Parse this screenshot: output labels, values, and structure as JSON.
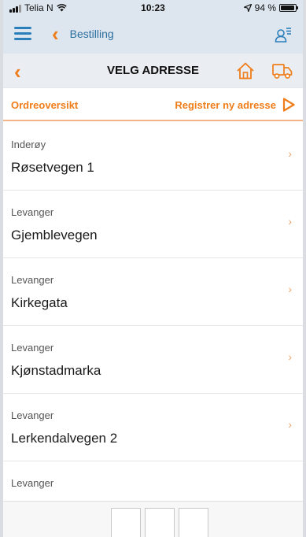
{
  "status_bar": {
    "carrier": "Telia N",
    "time": "10:23",
    "battery_percent": 94,
    "battery_label": "94 %"
  },
  "top_nav": {
    "title": "Bestilling"
  },
  "page_header": {
    "title": "VELG ADRESSE"
  },
  "actions": {
    "order_overview": "Ordreoversikt",
    "register_address": "Registrer ny adresse"
  },
  "addresses": [
    {
      "city": "Inderøy",
      "street": "Røsetvegen 1"
    },
    {
      "city": "Levanger",
      "street": "Gjemblevegen"
    },
    {
      "city": "Levanger",
      "street": "Kirkegata"
    },
    {
      "city": "Levanger",
      "street": "Kjønstadmarka"
    },
    {
      "city": "Levanger",
      "street": "Lerkendalvegen 2"
    },
    {
      "city": "Levanger",
      "street": ""
    }
  ],
  "icons": {
    "menu": "hamburger-icon",
    "back": "chevron-left-icon",
    "user_menu": "user-menu-icon",
    "home": "home-icon",
    "truck": "truck-icon",
    "register": "play-triangle-icon",
    "row": "chevron-right-icon"
  },
  "colors": {
    "accent": "#ef7d1a",
    "nav_blue": "#2a7fba",
    "nav_background": "#dde5ee",
    "header_background": "#eaeef2"
  }
}
